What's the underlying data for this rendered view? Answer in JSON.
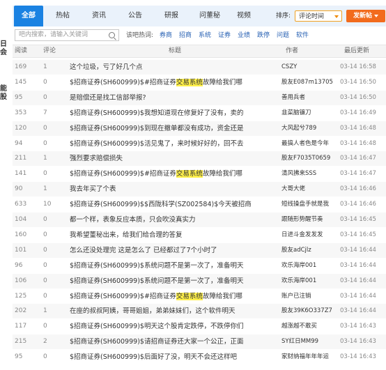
{
  "left_strip": [
    "日",
    "会",
    "能",
    "股"
  ],
  "tabs": [
    {
      "label": "全部",
      "active": true
    },
    {
      "label": "热帖",
      "active": false
    },
    {
      "label": "资讯",
      "active": false
    },
    {
      "label": "公告",
      "active": false
    },
    {
      "label": "研报",
      "active": false
    },
    {
      "label": "问董秘",
      "active": false
    },
    {
      "label": "视频",
      "active": false
    }
  ],
  "sort": {
    "label": "排序:",
    "value": "评论时间"
  },
  "post_button": "发新帖",
  "search": {
    "placeholder": "吧内搜索，请输入关键词"
  },
  "hot_words": {
    "label": "该吧热词:",
    "items": [
      "券商",
      "招商",
      "系统",
      "证券",
      "业绩",
      "跌停",
      "问题",
      "软件"
    ]
  },
  "table": {
    "headers": {
      "reads": "阅读",
      "comments": "评论",
      "title": "标题",
      "author": "作者",
      "updated": "最后更新"
    },
    "rows": [
      {
        "reads": "169",
        "comments": "1",
        "title_pre": "这个垃圾，亏了好几个点",
        "title_hl": "",
        "title_post": "",
        "author": "CSZY",
        "time": "03-14 16:58"
      },
      {
        "reads": "145",
        "comments": "0",
        "title_pre": "$招商证券(SH600999)$#招商证券",
        "title_hl": "交易系统",
        "title_post": "故障给我们哪",
        "author": "股友E087m13705",
        "time": "03-14 16:50"
      },
      {
        "reads": "95",
        "comments": "0",
        "title_pre": "是赔偿还是找工信部举报?",
        "title_hl": "",
        "title_post": "",
        "author": "善用兵者",
        "time": "03-14 16:50"
      },
      {
        "reads": "353",
        "comments": "7",
        "title_pre": "$招商证券(SH600999)$我想知道现在修复好了没有，卖的",
        "title_hl": "",
        "title_post": "",
        "author": "韭菜脑镰刀",
        "time": "03-14 16:49"
      },
      {
        "reads": "120",
        "comments": "0",
        "title_pre": "$招商证券(SH600999)$到现在撤单都没有成功，资金还是",
        "title_hl": "",
        "title_post": "",
        "author": "大风起兮789",
        "time": "03-14 16:48"
      },
      {
        "reads": "94",
        "comments": "0",
        "title_pre": "$招商证券(SH600999)$活见鬼了，来时候好好的，回不去",
        "title_hl": "",
        "title_post": "",
        "author": "最搞人者色是今年",
        "time": "03-14 16:48"
      },
      {
        "reads": "211",
        "comments": "1",
        "title_pre": "强烈要求赔偿损失",
        "title_hl": "",
        "title_post": "",
        "author": "股友F7035T0659",
        "time": "03-14 16:47"
      },
      {
        "reads": "141",
        "comments": "0",
        "title_pre": "$招商证券(SH600999)$#招商证券",
        "title_hl": "交易系统",
        "title_post": "故障给我们哪",
        "author": "清风拂来SSS",
        "time": "03-14 16:47"
      },
      {
        "reads": "90",
        "comments": "1",
        "title_pre": "我去年买了个表",
        "title_hl": "",
        "title_post": "",
        "author": "大哥大佬",
        "time": "03-14 16:46"
      },
      {
        "reads": "633",
        "comments": "10",
        "title_pre": "$招商证券(SH600999)$$西陇科学(SZ002584)$今天被招商",
        "title_hl": "",
        "title_post": "",
        "author": "短线操盘手就是我",
        "time": "03-14 16:46"
      },
      {
        "reads": "104",
        "comments": "0",
        "title_pre": "都一个样，表象反应本质，只会吹没真实力",
        "title_hl": "",
        "title_post": "",
        "author": "跟随形势醒节奏",
        "time": "03-14 16:45"
      },
      {
        "reads": "160",
        "comments": "0",
        "title_pre": "我希望董秘出来，给我们给合理的答复",
        "title_hl": "",
        "title_post": "",
        "author": "日进斗金发发发",
        "time": "03-14 16:45"
      },
      {
        "reads": "101",
        "comments": "0",
        "title_pre": "怎么还没处理完 这是怎么了 已经都过了7个小时了",
        "title_hl": "",
        "title_post": "",
        "author": "股友adCjlz",
        "time": "03-14 16:44"
      },
      {
        "reads": "96",
        "comments": "0",
        "title_pre": "$招商证券(SH600999)$系统问题不是第一次了，准备明天",
        "title_hl": "",
        "title_post": "",
        "author": "欢乐海岸001",
        "time": "03-14 16:44"
      },
      {
        "reads": "106",
        "comments": "0",
        "title_pre": "$招商证券(SH600999)$系统问题不是第一次了，准备明天",
        "title_hl": "",
        "title_post": "",
        "author": "欢乐海岸001",
        "time": "03-14 16:44"
      },
      {
        "reads": "125",
        "comments": "0",
        "title_pre": "$招商证券(SH600999)$#招商证券",
        "title_hl": "交易系统",
        "title_post": "故障给我们哪",
        "author": "账户已注销",
        "time": "03-14 16:44"
      },
      {
        "reads": "202",
        "comments": "1",
        "title_pre": "在座的叔叔阿姨，哥哥姐姐，弟弟妹妹们，这个软件明天",
        "title_hl": "",
        "title_post": "",
        "author": "股友39K6O337Z7",
        "time": "03-14 16:44"
      },
      {
        "reads": "117",
        "comments": "0",
        "title_pre": "$招商证券(SH600999)$明天这个股肯定跌停，不跌停你们",
        "title_hl": "",
        "title_post": "",
        "author": "越涨越不敢买",
        "time": "03-14 16:43"
      },
      {
        "reads": "215",
        "comments": "2",
        "title_pre": "$招商证券(SH600999)$请招商证券还大家一个公正，正面",
        "title_hl": "",
        "title_post": "",
        "author": "SY红日MM99",
        "time": "03-14 16:43"
      },
      {
        "reads": "95",
        "comments": "0",
        "title_pre": "$招商证券(SH600999)$后面好了没，明天不会还这样吧",
        "title_hl": "",
        "title_post": "",
        "author": "家财纳福年年年运",
        "time": "03-14 16:43"
      }
    ]
  }
}
